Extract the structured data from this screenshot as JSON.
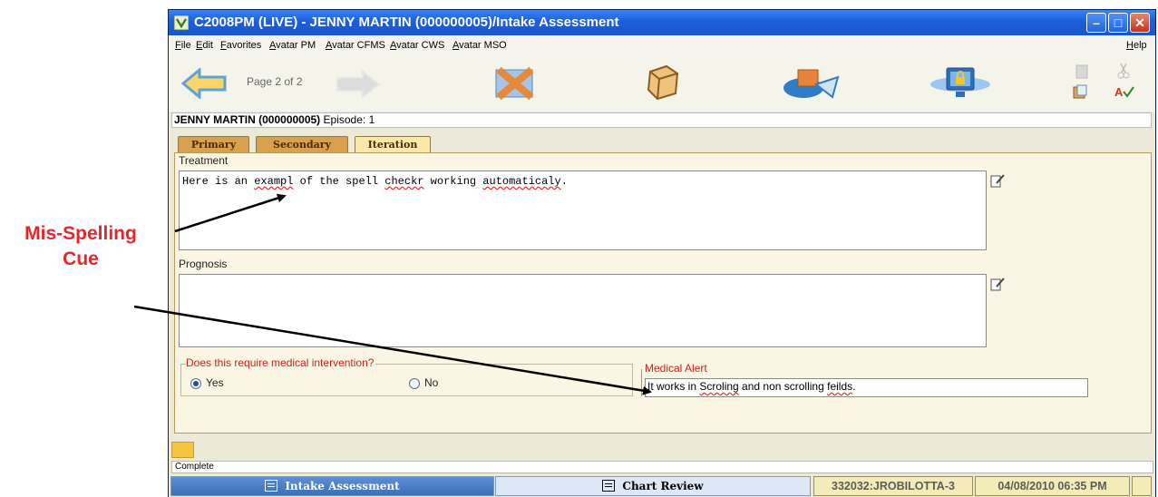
{
  "annotation": {
    "label_line1": "Mis-Spelling",
    "label_line2": "Cue",
    "color": "#e8252a"
  },
  "window": {
    "title": "C2008PM (LIVE) - JENNY MARTIN (000000005)/Intake Assessment",
    "buttons": [
      "minimize",
      "maximize",
      "close"
    ]
  },
  "menu": {
    "items": [
      "File",
      "Edit",
      "Favorites",
      "Avatar PM",
      "Avatar CFMS",
      "Avatar CWS",
      "Avatar MSO"
    ],
    "help": "Help"
  },
  "toolbar": {
    "page_info": "Page 2 of 2",
    "icons": [
      "back-arrow-icon",
      "forward-arrow-icon",
      "discard-x-icon",
      "form-icon",
      "submit-icon",
      "lock-monitor-icon",
      "copy-icon",
      "paste-icon",
      "cut-icon",
      "spellcheck-icon"
    ]
  },
  "client": {
    "name": "JENNY MARTIN (000000005)",
    "episode": "Episode: 1"
  },
  "tabs": [
    "Primary",
    "Secondary",
    "Iteration"
  ],
  "active_tab": "Iteration",
  "form": {
    "treatment_label": "Treatment",
    "treatment_parts": [
      {
        "text": "Here is an ",
        "misspelled": false
      },
      {
        "text": "exampl",
        "misspelled": true
      },
      {
        "text": " of the spell ",
        "misspelled": false
      },
      {
        "text": "checkr",
        "misspelled": true
      },
      {
        "text": " working ",
        "misspelled": false
      },
      {
        "text": "automaticaly",
        "misspelled": true
      },
      {
        "text": ".",
        "misspelled": false
      }
    ],
    "prognosis_label": "Prognosis",
    "prognosis_value": "",
    "medical_intervention_label": "Does this require medical intervention?",
    "yes_label": "Yes",
    "no_label": "No",
    "selected": "Yes",
    "medical_alert_label": "Medical Alert",
    "medical_alert_parts": [
      {
        "text": "It works in ",
        "misspelled": false
      },
      {
        "text": "Scroling",
        "misspelled": true
      },
      {
        "text": " and non scrolling ",
        "misspelled": false
      },
      {
        "text": "feilds",
        "misspelled": true
      },
      {
        "text": ".",
        "misspelled": false
      }
    ]
  },
  "status": {
    "text": "Complete"
  },
  "taskbar": {
    "active_task": "Intake Assessment",
    "other_task": "Chart Review",
    "user": "332032:JROBILOTTA-3",
    "datetime": "04/08/2010 06:35 PM"
  }
}
